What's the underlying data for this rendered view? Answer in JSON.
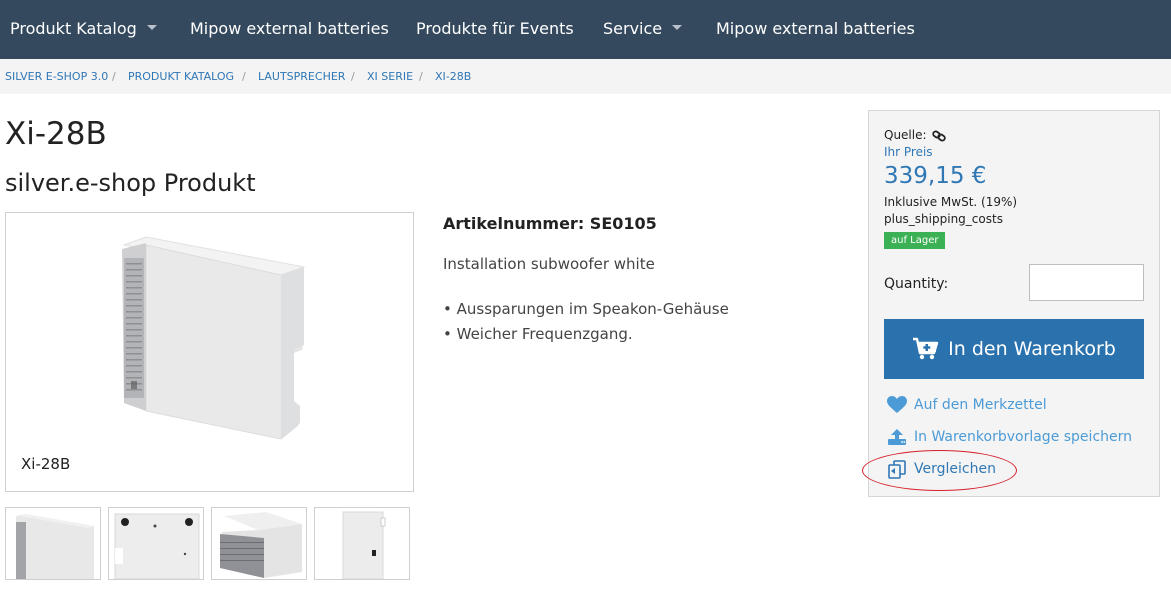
{
  "nav": {
    "items": [
      {
        "label": "Produkt Katalog",
        "dropdown": true
      },
      {
        "label": "Mipow external batteries",
        "dropdown": false
      },
      {
        "label": "Produkte für Events",
        "dropdown": false
      },
      {
        "label": "Service",
        "dropdown": true
      },
      {
        "label": "Mipow external batteries",
        "dropdown": false
      }
    ]
  },
  "breadcrumb": [
    "SILVER E-SHOP 3.0",
    "PRODUKT KATALOG",
    "LAUTSPRECHER",
    "XI SERIE",
    "XI-28B"
  ],
  "product": {
    "title": "Xi-28B",
    "subtitle": "silver.e-shop Produkt",
    "image_caption": "Xi-28B",
    "article_number": "Artikelnummer: SE0105",
    "description": "Installation subwoofer white",
    "features": [
      "• Aussparungen im Speakon-Gehäuse",
      "• Weicher Frequenzgang."
    ]
  },
  "buybox": {
    "source_label": "Quelle:",
    "price_label": "Ihr Preis",
    "price": "339,15 €",
    "vat": "Inklusive MwSt. (19%)",
    "shipping": "plus_shipping_costs",
    "stock": "auf Lager",
    "quantity_label": "Quantity:",
    "quantity_value": "",
    "cart_button": "In den Warenkorb",
    "wishlist": "Auf den Merkzettel",
    "save_template": "In Warenkorbvorlage speichern",
    "compare": "Vergleichen"
  },
  "colors": {
    "nav_bg": "#34495e",
    "accent": "#2a72ad",
    "link": "#2f77b5",
    "stock_badge": "#3cb054",
    "highlight": "#d6202a"
  },
  "icons": [
    "caret-down-icon",
    "link-icon",
    "cart-plus-icon",
    "heart-icon",
    "upload-icon",
    "compare-icon"
  ]
}
